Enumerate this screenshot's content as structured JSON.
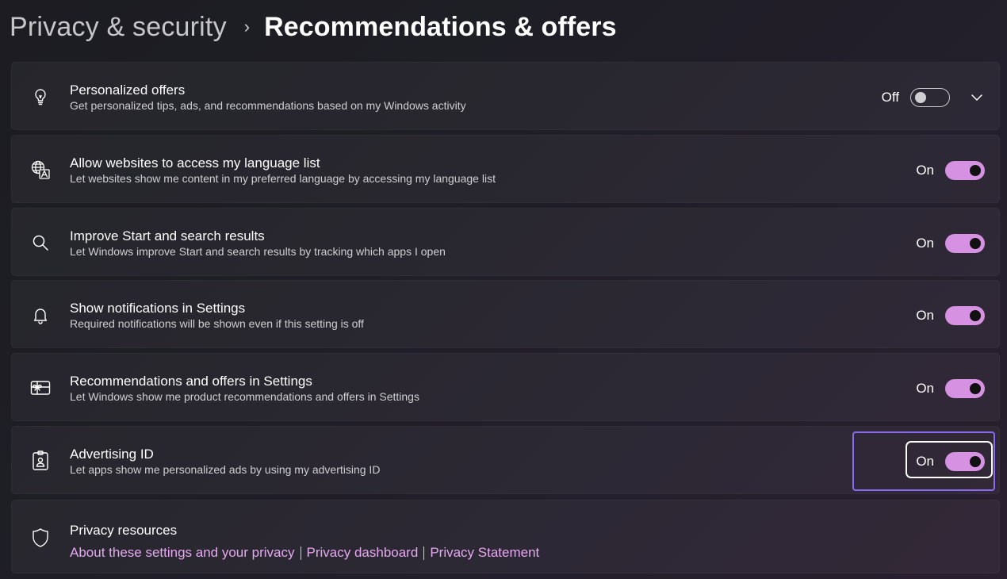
{
  "breadcrumb": {
    "parent": "Privacy & security",
    "separator": "›",
    "current": "Recommendations & offers"
  },
  "settings": [
    {
      "icon": "lightbulb-icon",
      "title": "Personalized offers",
      "description": "Get personalized tips, ads, and recommendations based on my Windows activity",
      "state_label": "Off",
      "enabled": false,
      "expandable": true
    },
    {
      "icon": "language-icon",
      "title": "Allow websites to access my language list",
      "description": "Let websites show me content in my preferred language by accessing my language list",
      "state_label": "On",
      "enabled": true
    },
    {
      "icon": "search-icon",
      "title": "Improve Start and search results",
      "description": "Let Windows improve Start and search results by tracking which apps I open",
      "state_label": "On",
      "enabled": true
    },
    {
      "icon": "bell-icon",
      "title": "Show notifications in Settings",
      "description": "Required notifications will be shown even if this setting is off",
      "state_label": "On",
      "enabled": true
    },
    {
      "icon": "gift-card-icon",
      "title": "Recommendations and offers in Settings",
      "description": "Let Windows show me product recommendations and offers in Settings",
      "state_label": "On",
      "enabled": true
    },
    {
      "icon": "id-badge-icon",
      "title": "Advertising ID",
      "description": "Let apps show me personalized ads by using my advertising ID",
      "state_label": "On",
      "enabled": true,
      "focused": true
    }
  ],
  "privacy_resources": {
    "icon": "shield-icon",
    "title": "Privacy resources",
    "links": [
      "About these settings and your privacy",
      "Privacy dashboard",
      "Privacy Statement"
    ]
  },
  "colors": {
    "accent": "#d691e3",
    "link": "#e6a8f0",
    "focus_outer": "#8a6cf0",
    "background": "#1f1e26"
  }
}
